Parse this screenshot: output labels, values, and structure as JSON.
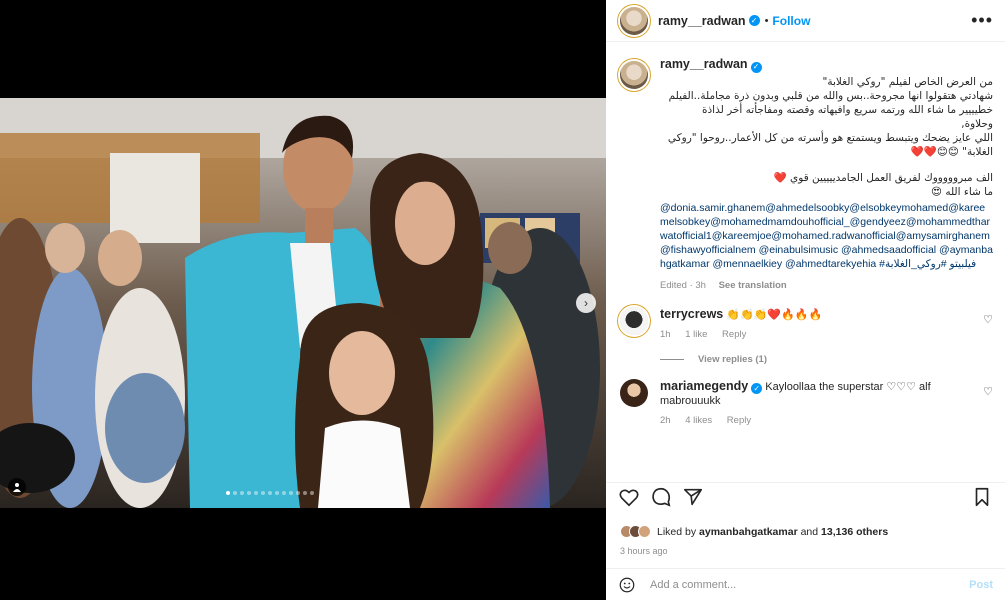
{
  "post_header": {
    "username": "ramy__radwan",
    "follow_label": "Follow",
    "more_label": "•••"
  },
  "caption": {
    "username": "ramy__radwan",
    "lines": [
      "من العرض الخاص لفيلم \"روكي الغلابة\"",
      "شهادتي هتقولوا انها مجروحة..بس والله من قلبي وبدون ذرة مجاملة..الفيلم",
      "خطيييير ما شاء الله ورتمه سريع وافيهاته وقصته ومفاجأته أخر لذاذة",
      "وحلاوة,",
      "اللي عايز يضحك ويتبسط ويستمتع هو وأسرته من كل الأعمار..روحوا \"روكي",
      "الغلابة\" 😊😊❤️❤️"
    ],
    "lines2": [
      "الف مبروووووك لفريق العمل الجامدييييين قوي ❤️",
      "ما شاء الله 😍"
    ],
    "mentions": "@donia.samir.ghanem@ahmedelsoobky@elsobkeymohamed@kareemelsobkey@mohamedmamdouhofficial_@gendyeez@mohammedtharwatofficial1@kareemjoe@mohamed.radwanofficial@amysamirghanem@fishawyofficialnem @einabulsimusic @ahmedsaadofficial @aymanbahgatkamar @mennaelkiey @ahmedtarekyehia #فيلبيتو #روكي_الغلابة",
    "edited": "Edited · 3h",
    "see_translation": "See translation"
  },
  "comments": [
    {
      "username": "terrycrews",
      "verified": false,
      "text": "👏👏👏❤️🔥🔥🔥",
      "time": "1h",
      "likes": "1 like",
      "reply": "Reply",
      "view_replies": "View replies (1)"
    },
    {
      "username": "mariamegendy",
      "verified": true,
      "text": "Kayloollaa the superstar ♡♡♡ alf mabrouuukk",
      "time": "2h",
      "likes": "4 likes",
      "reply": "Reply"
    }
  ],
  "likes": {
    "prefix": "Liked by",
    "user": "aymanbahgatkamar",
    "and": "and",
    "count": "13,136 others"
  },
  "time_ago": "3 hours ago",
  "add_comment": {
    "placeholder": "Add a comment...",
    "post_label": "Post"
  },
  "carousel": {
    "total": 13,
    "active_index": 0
  },
  "colors": {
    "accent": "#0095f6",
    "link": "#00376b",
    "muted": "#8e8e8e",
    "heart": "#ed4956"
  }
}
